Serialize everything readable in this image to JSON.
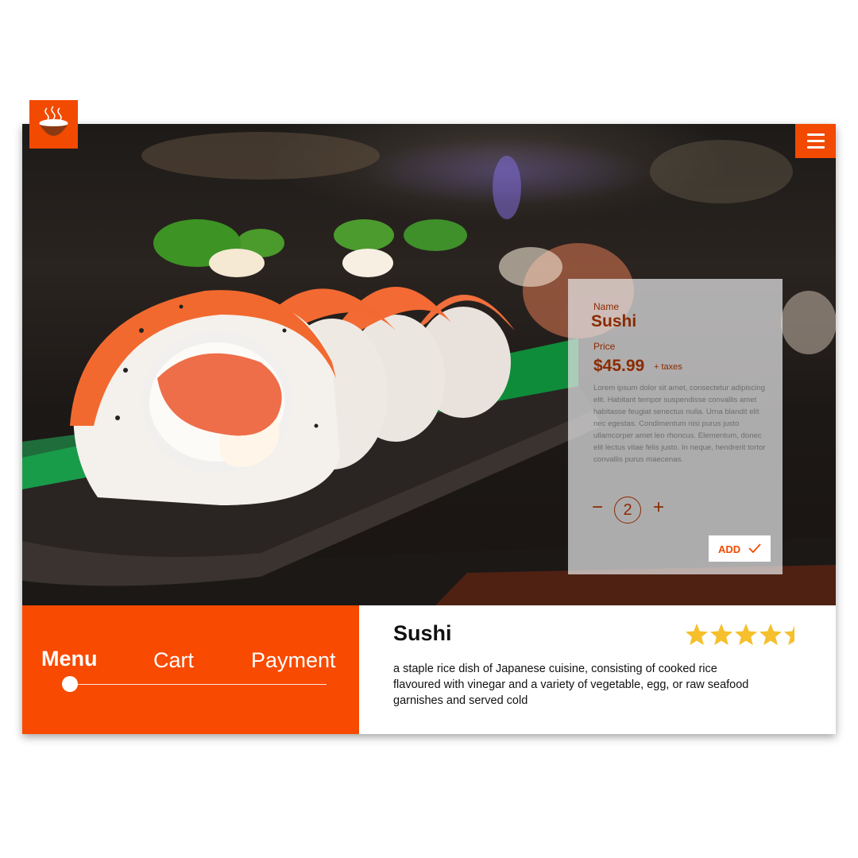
{
  "header": {
    "logo_icon": "steaming-bowl-icon",
    "menu_icon": "hamburger-menu-icon",
    "accent_color": "#f24a00"
  },
  "product_card": {
    "name_label": "Name",
    "name": "Sushi",
    "price_label": "Price",
    "price": "$45.99",
    "tax_note": "+ taxes",
    "description": "Lorem ipsum dolor sit amet, consectetur adipiscing elit. Habitant tempor suspendisse convallis amet habitasse feugiat senectus nulla. Urna blandit elit nec egestas. Condimentum nisi purus justo ullamcorper amet leo rhoncus. Elementum, donec elit lectus vitae felis justo. In neque, hendrerit tortor convallis purus maecenas.",
    "quantity": "2",
    "decrement_symbol": "−",
    "increment_symbol": "+",
    "add_label": "ADD",
    "add_icon": "checkmark-icon"
  },
  "nav": {
    "items": [
      {
        "label": "Menu",
        "active": true
      },
      {
        "label": "Cart",
        "active": false
      },
      {
        "label": "Payment",
        "active": false
      }
    ],
    "progress_step": 1
  },
  "details": {
    "title": "Sushi",
    "description": "a staple rice dish of Japanese cuisine, consisting of cooked rice flavoured with vinegar and a variety of vegetable, egg, or raw seafood garnishes and served cold",
    "rating": 4.5,
    "rating_max": 5,
    "star_color": "#f6bf2c"
  }
}
